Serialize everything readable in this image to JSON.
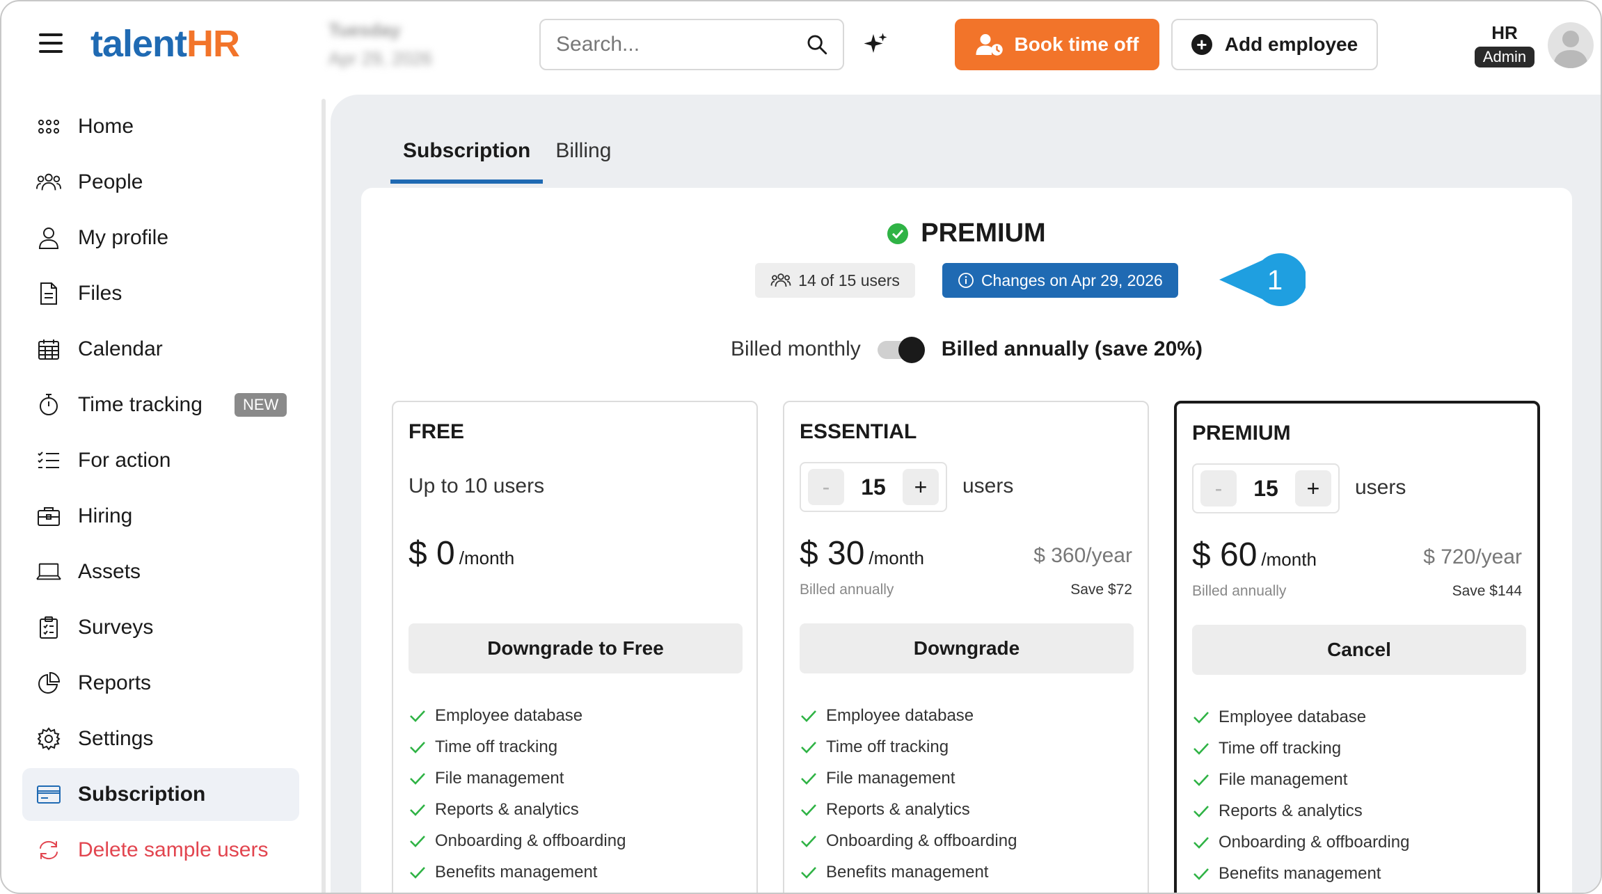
{
  "header": {
    "logo_part1": "talent",
    "logo_part2": "HR",
    "date_line1": "Tuesday",
    "date_line2": "Apr 29, 2026",
    "search_placeholder": "Search...",
    "book_time_off": "Book time off",
    "add_employee": "Add employee",
    "user_name": "HR",
    "user_role": "Admin"
  },
  "sidebar": {
    "items": [
      {
        "label": "Home",
        "icon": "grid-icon"
      },
      {
        "label": "People",
        "icon": "people-icon"
      },
      {
        "label": "My profile",
        "icon": "user-icon"
      },
      {
        "label": "Files",
        "icon": "file-icon"
      },
      {
        "label": "Calendar",
        "icon": "calendar-icon"
      },
      {
        "label": "Time tracking",
        "icon": "stopwatch-icon",
        "badge": "NEW"
      },
      {
        "label": "For action",
        "icon": "checklist-icon"
      },
      {
        "label": "Hiring",
        "icon": "briefcase-icon"
      },
      {
        "label": "Assets",
        "icon": "laptop-icon"
      },
      {
        "label": "Surveys",
        "icon": "clipboard-icon"
      },
      {
        "label": "Reports",
        "icon": "pie-chart-icon"
      },
      {
        "label": "Settings",
        "icon": "gear-icon"
      },
      {
        "label": "Subscription",
        "icon": "card-icon",
        "active": true
      },
      {
        "label": "Delete sample users",
        "icon": "refresh-icon",
        "danger": true
      }
    ]
  },
  "tabs": [
    {
      "label": "Subscription",
      "active": true
    },
    {
      "label": "Billing",
      "active": false
    }
  ],
  "current_plan": {
    "name": "PREMIUM",
    "users_chip": "14 of 15 users",
    "changes_chip": "Changes on Apr 29, 2026",
    "marker_number": "1"
  },
  "billing_toggle": {
    "monthly_label": "Billed monthly",
    "annual_label": "Billed annually (save 20%)",
    "annual_selected": true
  },
  "plans": [
    {
      "name": "FREE",
      "users_text": "Up to 10 users",
      "price": "$ 0",
      "per": "/month",
      "button": "Downgrade to Free",
      "features": [
        "Employee database",
        "Time off tracking",
        "File management",
        "Reports & analytics",
        "Onboarding & offboarding",
        "Benefits management"
      ]
    },
    {
      "name": "ESSENTIAL",
      "stepper_minus": "-",
      "users_count": "15",
      "stepper_plus": "+",
      "users_label": "users",
      "price": "$ 30",
      "per": "/month",
      "yearly": "$ 360/year",
      "billed_note": "Billed annually",
      "save_note": "Save $72",
      "button": "Downgrade",
      "features": [
        "Employee database",
        "Time off tracking",
        "File management",
        "Reports & analytics",
        "Onboarding & offboarding",
        "Benefits management"
      ]
    },
    {
      "name": "PREMIUM",
      "stepper_minus": "-",
      "users_count": "15",
      "stepper_plus": "+",
      "users_label": "users",
      "price": "$ 60",
      "per": "/month",
      "yearly": "$ 720/year",
      "billed_note": "Billed annually",
      "save_note": "Save $144",
      "button": "Cancel",
      "features": [
        "Employee database",
        "Time off tracking",
        "File management",
        "Reports & analytics",
        "Onboarding & offboarding",
        "Benefits management"
      ]
    }
  ],
  "colors": {
    "brand_blue": "#1f6ab3",
    "brand_orange": "#f2742a",
    "check_green": "#2fb345",
    "marker_blue": "#1f9fe0",
    "danger_red": "#e2454f"
  }
}
